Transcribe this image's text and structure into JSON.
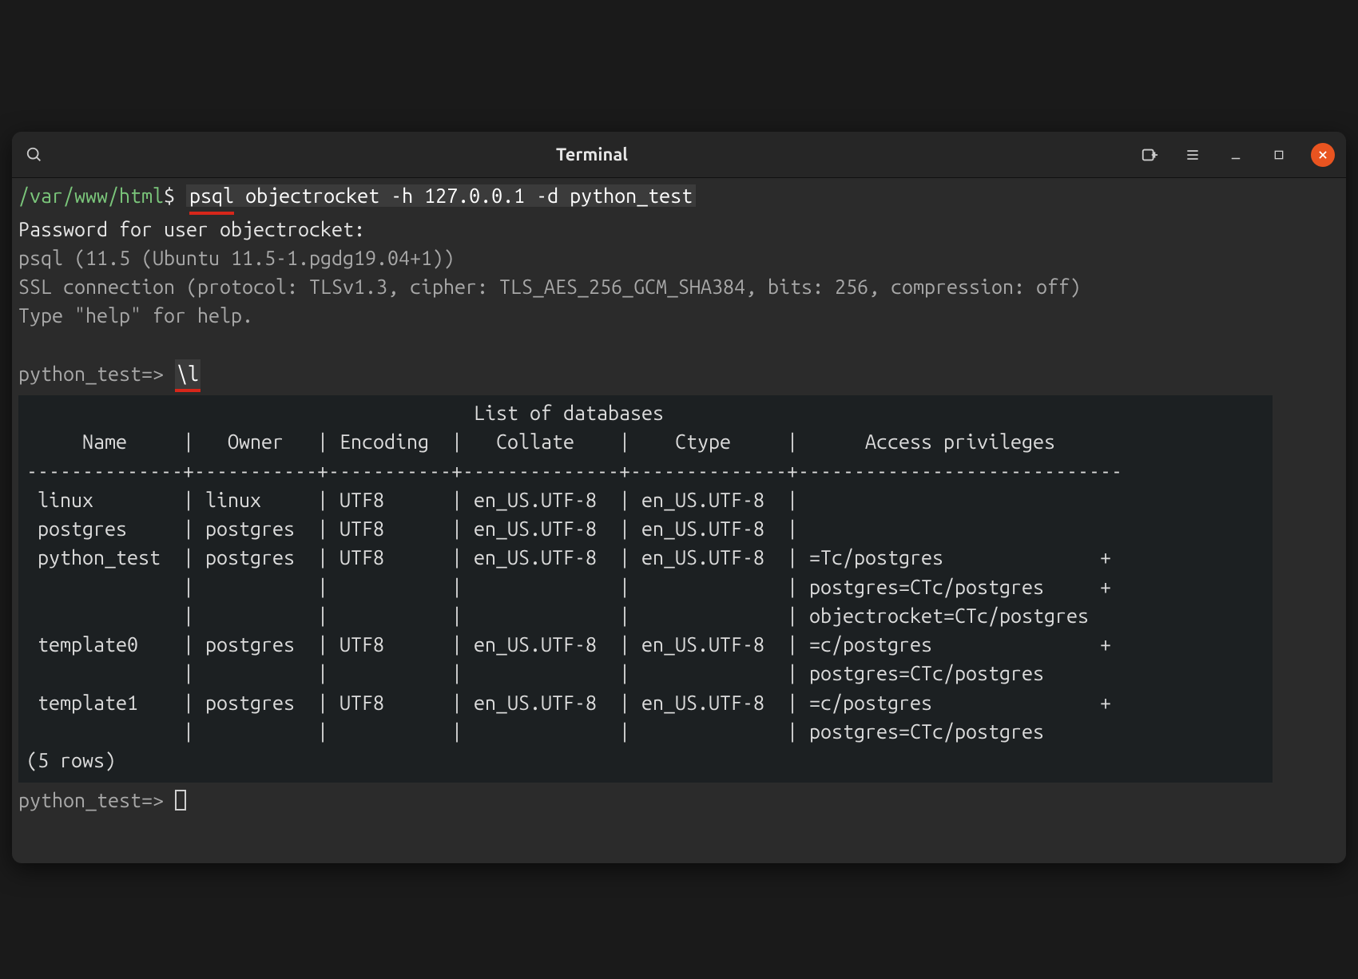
{
  "window": {
    "title": "Terminal"
  },
  "shell": {
    "path": "/var/www/html",
    "dollar": "$",
    "command_pre": "psql",
    "command_rest": " objectrocket -h 127.0.0.1 -d python_test"
  },
  "psql": {
    "pw_prompt": "Password for user objectrocket:",
    "banner_version": "psql (11.5 (Ubuntu 11.5-1.pgdg19.04+1))",
    "banner_ssl": "SSL connection (protocol: TLSv1.3, cipher: TLS_AES_256_GCM_SHA384, bits: 256, compression: off)",
    "banner_help": "Type \"help\" for help.",
    "prompt": "python_test=>",
    "list_cmd": "\\l",
    "table": {
      "title": "List of databases",
      "headers": [
        "Name",
        "Owner",
        "Encoding",
        "Collate",
        "Ctype",
        "Access privileges"
      ],
      "rows": [
        {
          "name": "linux",
          "owner": "linux",
          "encoding": "UTF8",
          "collate": "en_US.UTF-8",
          "ctype": "en_US.UTF-8",
          "priv": [
            ""
          ]
        },
        {
          "name": "postgres",
          "owner": "postgres",
          "encoding": "UTF8",
          "collate": "en_US.UTF-8",
          "ctype": "en_US.UTF-8",
          "priv": [
            ""
          ]
        },
        {
          "name": "python_test",
          "owner": "postgres",
          "encoding": "UTF8",
          "collate": "en_US.UTF-8",
          "ctype": "en_US.UTF-8",
          "priv": [
            "=Tc/postgres              +",
            "postgres=CTc/postgres     +",
            "objectrocket=CTc/postgres"
          ]
        },
        {
          "name": "template0",
          "owner": "postgres",
          "encoding": "UTF8",
          "collate": "en_US.UTF-8",
          "ctype": "en_US.UTF-8",
          "priv": [
            "=c/postgres               +",
            "postgres=CTc/postgres"
          ]
        },
        {
          "name": "template1",
          "owner": "postgres",
          "encoding": "UTF8",
          "collate": "en_US.UTF-8",
          "ctype": "en_US.UTF-8",
          "priv": [
            "=c/postgres               +",
            "postgres=CTc/postgres"
          ]
        }
      ],
      "row_count_label": "(5 rows)"
    }
  }
}
